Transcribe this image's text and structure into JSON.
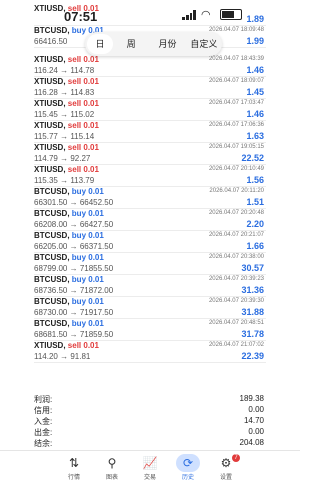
{
  "status": {
    "time": "07:51"
  },
  "period_tabs": [
    "日",
    "周",
    "月份",
    "自定义"
  ],
  "trades": [
    {
      "symbol": "XTIUSD",
      "side": "sell",
      "side_label": "sell 0.01",
      "prices": "",
      "datetime": "",
      "pnl": "1.89"
    },
    {
      "symbol": "BTCUSD",
      "side": "buy",
      "side_label": "buy 0.01",
      "prices": "66416.50",
      "datetime": "2026.04.07 18:09:48",
      "pnl": "1.99"
    },
    {
      "symbol": "XTIUSD",
      "side": "sell",
      "side_label": "sell 0.01",
      "prices": "116.24 → 114.78",
      "datetime": "2026.04.07 18:43:39",
      "pnl": "1.46"
    },
    {
      "symbol": "XTIUSD",
      "side": "sell",
      "side_label": "sell 0.01",
      "prices": "116.28 → 114.83",
      "datetime": "2026.04.07 18:09:07",
      "pnl": "1.45"
    },
    {
      "symbol": "XTIUSD",
      "side": "sell",
      "side_label": "sell 0.01",
      "prices": "115.45 → 115.02",
      "datetime": "2026.04.07 17:03:47",
      "pnl": "1.46"
    },
    {
      "symbol": "XTIUSD",
      "side": "sell",
      "side_label": "sell 0.01",
      "prices": "115.77 → 115.14",
      "datetime": "2026.04.07 17:06:36",
      "pnl": "1.63"
    },
    {
      "symbol": "XTIUSD",
      "side": "sell",
      "side_label": "sell 0.01",
      "prices": "114.79 → 92.27",
      "datetime": "2026.04.07 19:05:15",
      "pnl": "22.52"
    },
    {
      "symbol": "XTIUSD",
      "side": "sell",
      "side_label": "sell 0.01",
      "prices": "115.35 → 113.79",
      "datetime": "2026.04.07 20:10:49",
      "pnl": "1.56"
    },
    {
      "symbol": "BTCUSD",
      "side": "buy",
      "side_label": "buy 0.01",
      "prices": "66301.50 → 66452.50",
      "datetime": "2026.04.07 20:11:20",
      "pnl": "1.51"
    },
    {
      "symbol": "BTCUSD",
      "side": "buy",
      "side_label": "buy 0.01",
      "prices": "66208.00 → 66427.50",
      "datetime": "2026.04.07 20:20:48",
      "pnl": "2.20"
    },
    {
      "symbol": "BTCUSD",
      "side": "buy",
      "side_label": "buy 0.01",
      "prices": "66205.00 → 66371.50",
      "datetime": "2026.04.07 20:21:07",
      "pnl": "1.66"
    },
    {
      "symbol": "BTCUSD",
      "side": "buy",
      "side_label": "buy 0.01",
      "prices": "68799.00 → 71855.50",
      "datetime": "2026.04.07 20:38:00",
      "pnl": "30.57"
    },
    {
      "symbol": "BTCUSD",
      "side": "buy",
      "side_label": "buy 0.01",
      "prices": "68736.50 → 71872.00",
      "datetime": "2026.04.07 20:39:23",
      "pnl": "31.36"
    },
    {
      "symbol": "BTCUSD",
      "side": "buy",
      "side_label": "buy 0.01",
      "prices": "68730.00 → 71917.50",
      "datetime": "2026.04.07 20:39:30",
      "pnl": "31.88"
    },
    {
      "symbol": "BTCUSD",
      "side": "buy",
      "side_label": "buy 0.01",
      "prices": "68681.50 → 71859.50",
      "datetime": "2026.04.07 20:48:51",
      "pnl": "31.78"
    },
    {
      "symbol": "XTIUSD",
      "side": "sell",
      "side_label": "sell 0.01",
      "prices": "114.20 → 91.81",
      "datetime": "2026.04.07 21:07:02",
      "pnl": "22.39"
    }
  ],
  "summary": [
    {
      "label": "利润:",
      "value": "189.38"
    },
    {
      "label": "信用:",
      "value": "0.00"
    },
    {
      "label": "入金:",
      "value": "14.70"
    },
    {
      "label": "出金:",
      "value": "0.00"
    },
    {
      "label": "结余:",
      "value": "204.08"
    }
  ],
  "nav": [
    {
      "icon": "⇅",
      "label": "行情",
      "active": false
    },
    {
      "icon": "⚲",
      "label": "图表",
      "active": false
    },
    {
      "icon": "📈",
      "label": "交易",
      "active": false
    },
    {
      "icon": "⟳",
      "label": "历史",
      "active": true
    },
    {
      "icon": "⚙",
      "label": "设置",
      "active": false,
      "badge": "7"
    }
  ],
  "colors": {
    "buy": "#2a6de0",
    "sell": "#e13b3b",
    "profit": "#2a6de0"
  }
}
